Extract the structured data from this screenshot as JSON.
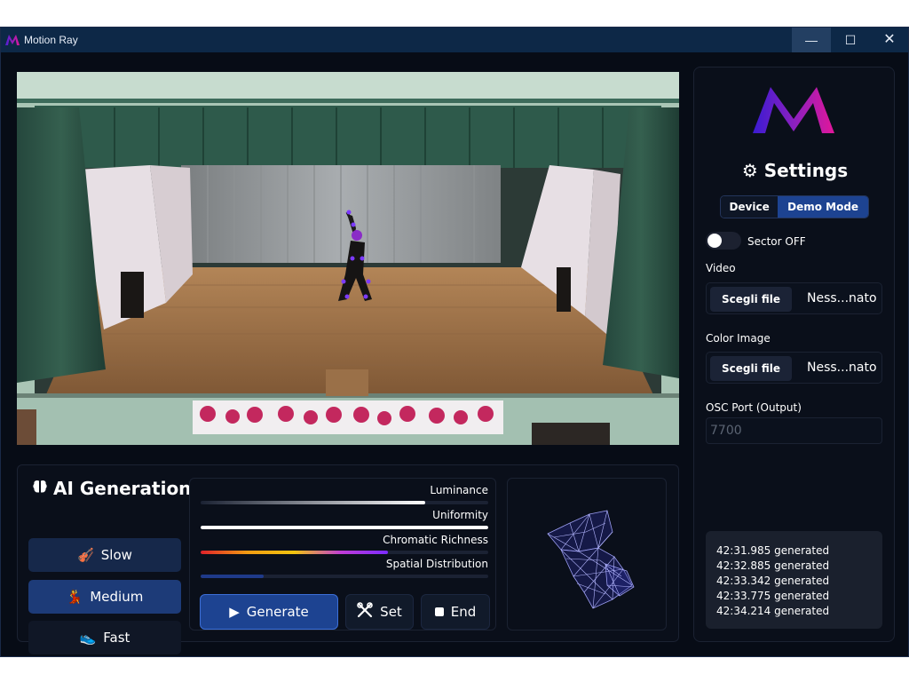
{
  "window": {
    "title": "Motion Ray",
    "controls": {
      "minimize": "—",
      "maximize": "☐",
      "close": "✕"
    }
  },
  "ai_generation": {
    "title": "AI Generation",
    "icon": "brain-icon",
    "speed_buttons": [
      {
        "label": "Slow",
        "icon": "violin-icon",
        "active": false
      },
      {
        "label": "Medium",
        "icon": "dancer-icon",
        "active": true
      },
      {
        "label": "Fast",
        "icon": "shoe-icon",
        "active": false
      }
    ]
  },
  "metrics": [
    {
      "label": "Luminance",
      "value": 0.78,
      "color": "gradient-gray"
    },
    {
      "label": "Uniformity",
      "value": 1.0,
      "color": "#ffffff"
    },
    {
      "label": "Chromatic Richness",
      "value": 0.65,
      "color": "gradient-rainbow"
    },
    {
      "label": "Spatial Distribution",
      "value": 0.22,
      "color": "#1f3a8a"
    }
  ],
  "actions": {
    "generate": "Generate",
    "set": "Set",
    "end": "End"
  },
  "settings": {
    "title": "Settings",
    "mode_tabs": {
      "device": "Device",
      "demo": "Demo Mode",
      "selected": "Demo Mode"
    },
    "sector_toggle": {
      "label": "Sector OFF",
      "on": false
    },
    "video": {
      "label": "Video",
      "button": "Scegli file",
      "file_name": "Ness...nato"
    },
    "color_image": {
      "label": "Color Image",
      "button": "Scegli file",
      "file_name": "Ness...nato"
    },
    "osc_port": {
      "label": "OSC Port (Output)",
      "placeholder": "7700"
    }
  },
  "log": [
    "42:31.985 generated",
    "42:32.885 generated",
    "42:33.342 generated",
    "42:33.775 generated",
    "42:34.214 generated"
  ],
  "colors": {
    "accent": "#1d4391",
    "background": "#070c16",
    "titlebar": "#0d2847",
    "logo_gradient": [
      "#4b1fd6",
      "#e01a9a"
    ]
  }
}
